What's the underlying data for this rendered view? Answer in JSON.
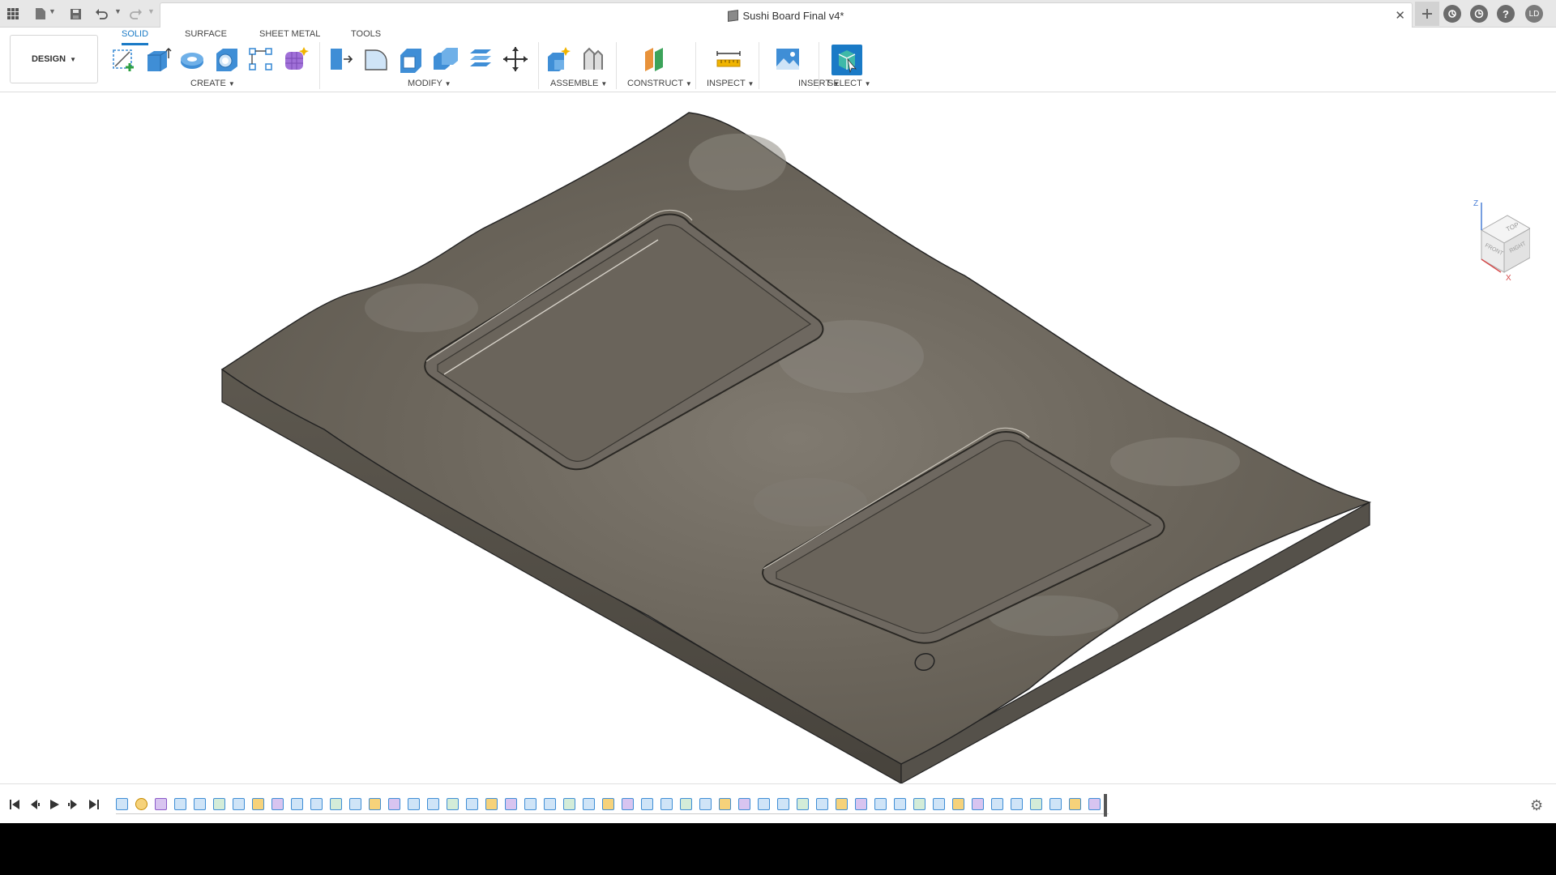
{
  "titlebar": {
    "document_title": "Sushi Board Final v4*",
    "icons": [
      "grid-icon",
      "file-icon",
      "save-icon",
      "undo-icon",
      "redo-icon",
      "close-icon",
      "new-tab-icon",
      "extensions-icon",
      "job-status-icon",
      "help-icon"
    ],
    "user_initials": "LD"
  },
  "toolbar": {
    "workspace_label": "DESIGN",
    "tabs": [
      {
        "label": "SOLID",
        "active": true
      },
      {
        "label": "SURFACE",
        "active": false
      },
      {
        "label": "SHEET METAL",
        "active": false
      },
      {
        "label": "TOOLS",
        "active": false
      }
    ],
    "groups": {
      "create": "CREATE",
      "modify": "MODIFY",
      "assemble": "ASSEMBLE",
      "construct": "CONSTRUCT",
      "inspect": "INSPECT",
      "insert": "INSERT",
      "select": "SELECT"
    },
    "accent_color": "#1a7ac6"
  },
  "viewcube": {
    "faces": [
      "TOP",
      "FRONT",
      "RIGHT"
    ],
    "axes": [
      "Z",
      "X"
    ]
  },
  "timeline": {
    "controls": [
      "skip-to-start",
      "step-back",
      "play",
      "step-forward",
      "skip-to-end"
    ],
    "feature_count": 51
  }
}
